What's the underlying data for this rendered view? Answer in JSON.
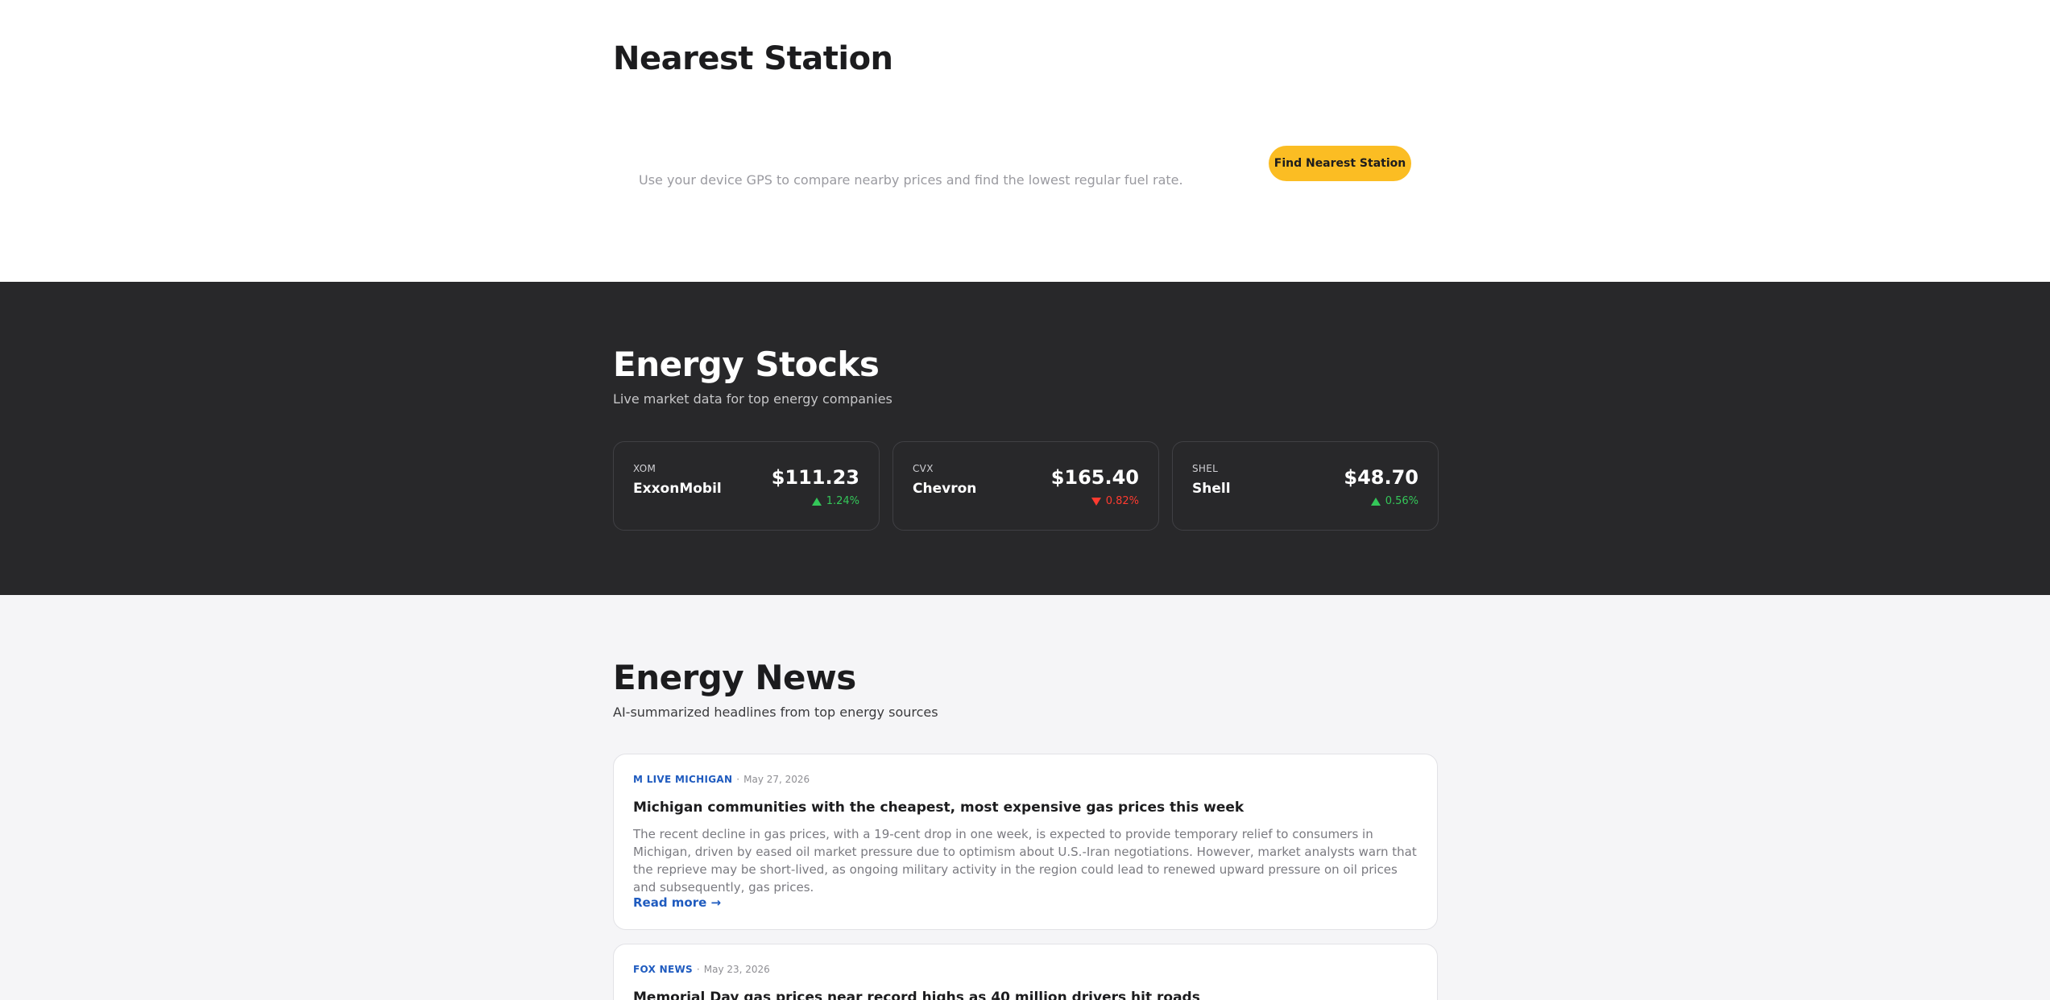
{
  "station": {
    "title": "Nearest Station",
    "description": "Use your device GPS to compare nearby prices and find the lowest regular fuel rate.",
    "button_label": "Find Nearest Station"
  },
  "stocks": {
    "title": "Energy Stocks",
    "subtitle": "Live market data for top energy companies",
    "items": [
      {
        "ticker": "XOM",
        "name": "ExxonMobil",
        "price": "$111.23",
        "change": "1.24%",
        "direction": "up"
      },
      {
        "ticker": "CVX",
        "name": "Chevron",
        "price": "$165.40",
        "change": "0.82%",
        "direction": "down"
      },
      {
        "ticker": "SHEL",
        "name": "Shell",
        "price": "$48.70",
        "change": "0.56%",
        "direction": "up"
      }
    ]
  },
  "news": {
    "title": "Energy News",
    "subtitle": "AI-summarized headlines from top energy sources",
    "items": [
      {
        "source": "M LIVE MICHIGAN",
        "date": "May 27, 2026",
        "headline": "Michigan communities with the cheapest, most expensive gas prices this week",
        "summary": "The recent decline in gas prices, with a 19-cent drop in one week, is expected to provide temporary relief to consumers in Michigan, driven by eased oil market pressure due to optimism about U.S.-Iran negotiations. However, market analysts warn that the reprieve may be short-lived, as ongoing military activity in the region could lead to renewed upward pressure on oil prices and subsequently, gas prices.",
        "read_more": "Read more →"
      },
      {
        "source": "FOX NEWS",
        "date": "May 23, 2026",
        "headline": "Memorial Day gas prices near record highs as 40 million drivers hit roads"
      }
    ]
  },
  "colors": {
    "accent": "#fbbd23",
    "dark_bg": "#28282a",
    "up": "#34c759",
    "down": "#ff3b30",
    "link": "#1f5bbf"
  }
}
